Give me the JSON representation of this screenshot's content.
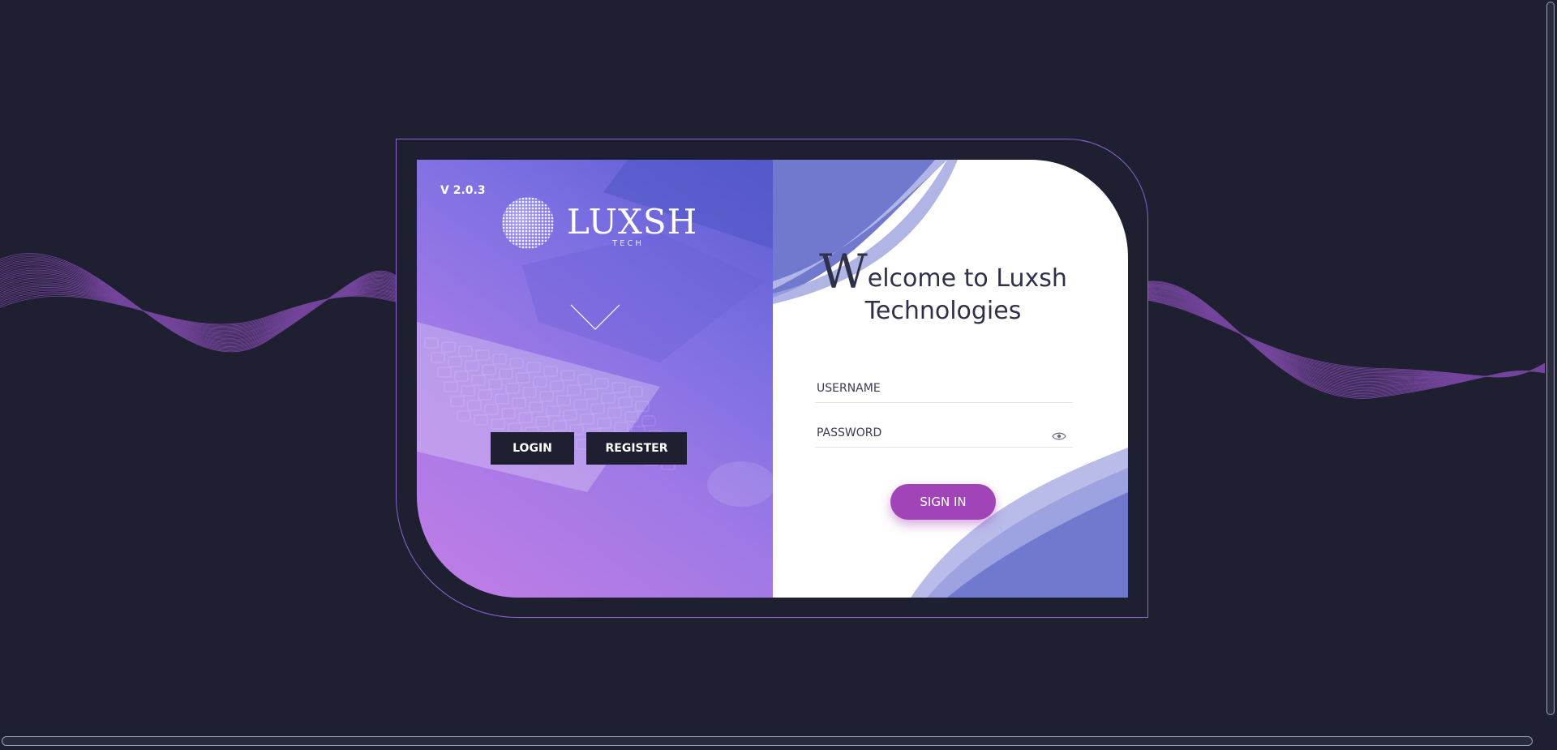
{
  "app": {
    "version": "V 2.0.3",
    "logo": {
      "name": "LUXSH",
      "sub": "TECH"
    }
  },
  "nav": {
    "login_label": "LOGIN",
    "register_label": "REGISTER"
  },
  "form": {
    "welcome_initial": "W",
    "welcome_rest_line1": "elcome to Luxsh",
    "welcome_line2": "Technologies",
    "username_placeholder": "USERNAME",
    "password_placeholder": "PASSWORD",
    "sign_in_label": "SIGN IN"
  },
  "icons": {
    "down_arrow": "chevron-down-icon",
    "password_toggle": "eye-icon",
    "logo_globe": "globe-icon"
  },
  "colors": {
    "background": "#1e1f30",
    "accent": "#a044b8",
    "frame_border": "#8d63d6",
    "panel_gradient_start": "#c27de6",
    "panel_gradient_end": "#5a5bd0",
    "wave_blue": "#7179cf"
  }
}
